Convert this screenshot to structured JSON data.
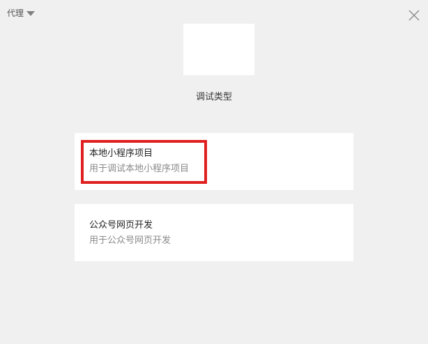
{
  "header": {
    "proxy_label": "代理",
    "proxy_icon": "triangle-down-icon",
    "close_icon": "close-icon"
  },
  "main": {
    "title": "调试类型",
    "options": [
      {
        "title": "本地小程序项目",
        "description": "用于调试本地小程序项目",
        "highlighted": true
      },
      {
        "title": "公众号网页开发",
        "description": "用于公众号网页开发",
        "highlighted": false
      }
    ]
  },
  "colors": {
    "background": "#f0f0f0",
    "card": "#ffffff",
    "highlight": "#e02020",
    "text_primary": "#222222",
    "text_secondary": "#8a8a8a"
  }
}
